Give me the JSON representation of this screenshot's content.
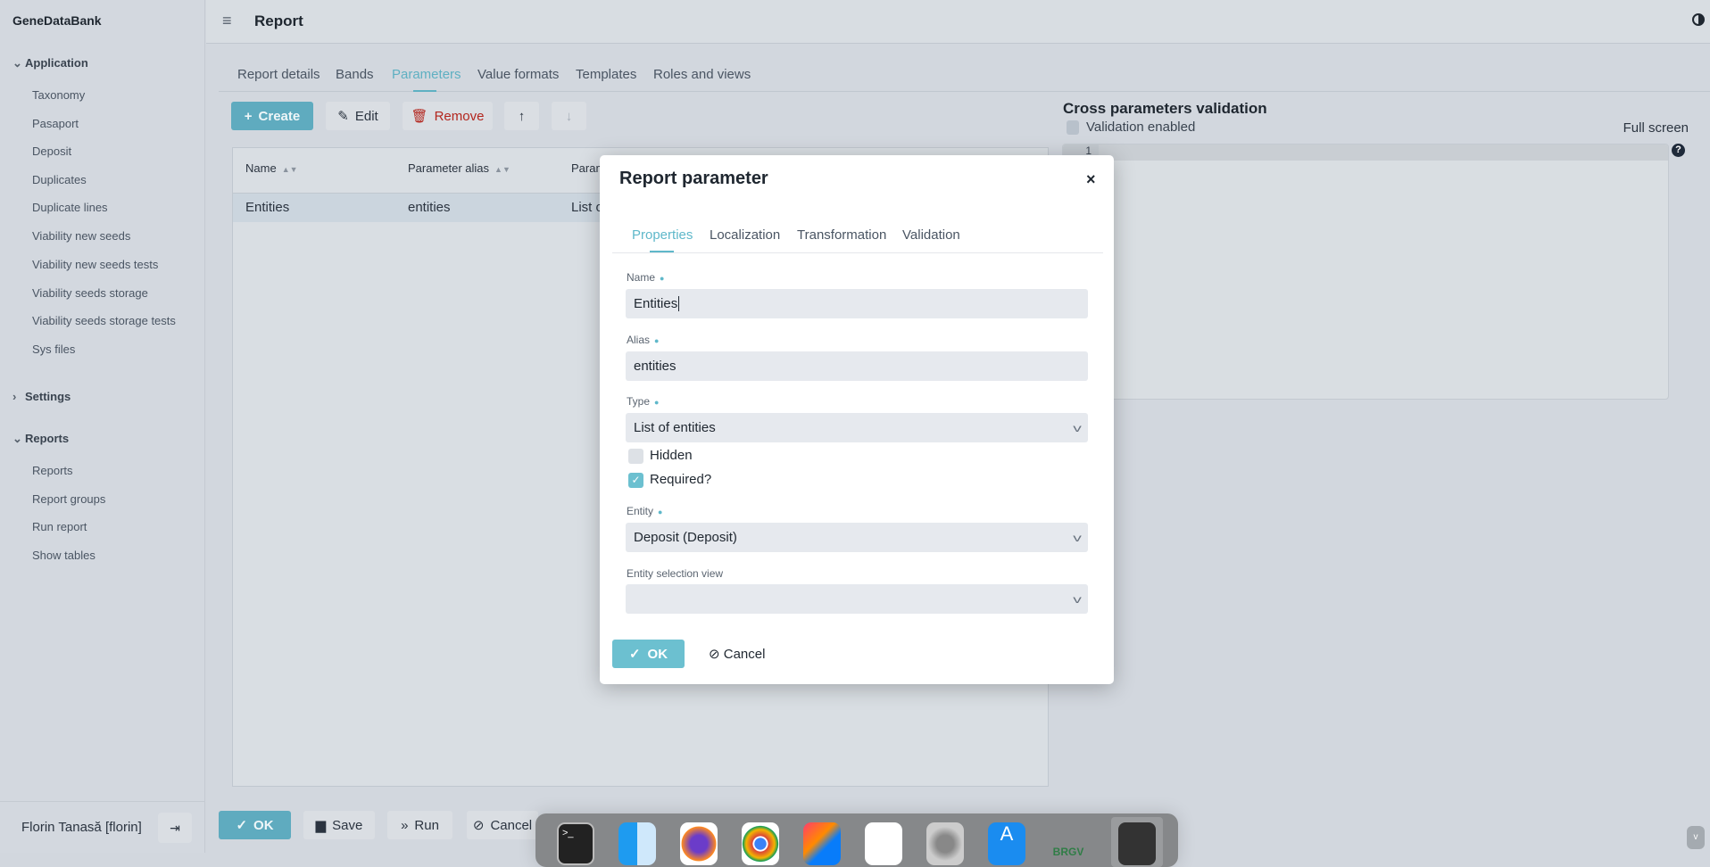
{
  "app": {
    "brand": "GeneDataBank"
  },
  "sidebar": {
    "sections": [
      {
        "label": "Application",
        "expanded": true,
        "items": [
          "Taxonomy",
          "Pasaport",
          "Deposit",
          "Duplicates",
          "Duplicate lines",
          "Viability new seeds",
          "Viability new seeds tests",
          "Viability seeds storage",
          "Viability seeds storage tests",
          "Sys files"
        ]
      },
      {
        "label": "Settings",
        "expanded": false,
        "items": []
      },
      {
        "label": "Reports",
        "expanded": true,
        "items": [
          "Reports",
          "Report groups",
          "Run report",
          "Show tables"
        ]
      }
    ],
    "user": "Florin Tanasă [florin]"
  },
  "header": {
    "title": "Report",
    "icons": [
      "menu-icon",
      "contrast-icon"
    ]
  },
  "tabs": [
    {
      "label": "Report details"
    },
    {
      "label": "Bands"
    },
    {
      "label": "Parameters",
      "active": true
    },
    {
      "label": "Value formats"
    },
    {
      "label": "Templates"
    },
    {
      "label": "Roles and views"
    }
  ],
  "toolbar": {
    "create": "Create",
    "edit": "Edit",
    "remove": "Remove"
  },
  "table": {
    "columns": [
      "Name",
      "Parameter alias",
      "Param"
    ],
    "rows": [
      [
        "Entities",
        "entities",
        "List o"
      ]
    ]
  },
  "validation": {
    "title": "Cross parameters validation",
    "enabled_label": "Validation enabled",
    "enabled": false,
    "full_screen": "Full screen",
    "line_number": "1",
    "help": "?"
  },
  "bottom": {
    "ok": "OK",
    "save": "Save",
    "run": "Run",
    "cancel": "Cancel"
  },
  "modal": {
    "title": "Report parameter",
    "close": "×",
    "tabs": [
      "Properties",
      "Localization",
      "Transformation",
      "Validation"
    ],
    "active_tab": "Properties",
    "fields": {
      "name_label": "Name",
      "name_value": "Entities",
      "alias_label": "Alias",
      "alias_value": "entities",
      "type_label": "Type",
      "type_value": "List of entities",
      "hidden_label": "Hidden",
      "hidden": false,
      "required_label": "Required?",
      "required": true,
      "entity_label": "Entity",
      "entity_value": "Deposit (Deposit)",
      "view_label": "Entity selection view",
      "view_value": ""
    },
    "ok": "OK",
    "cancel": "Cancel"
  },
  "dock": {
    "apps": [
      "terminal-icon",
      "finder-icon",
      "firefox-icon",
      "chrome-icon",
      "intellij-icon",
      "dbeaver-icon",
      "system-settings-icon",
      "app-store-icon",
      "brgv-icon",
      "screenshot-icon"
    ]
  },
  "colors": {
    "accent": "#5fabbf",
    "danger": "#b3261e",
    "sidebar": "#d3d8df"
  }
}
